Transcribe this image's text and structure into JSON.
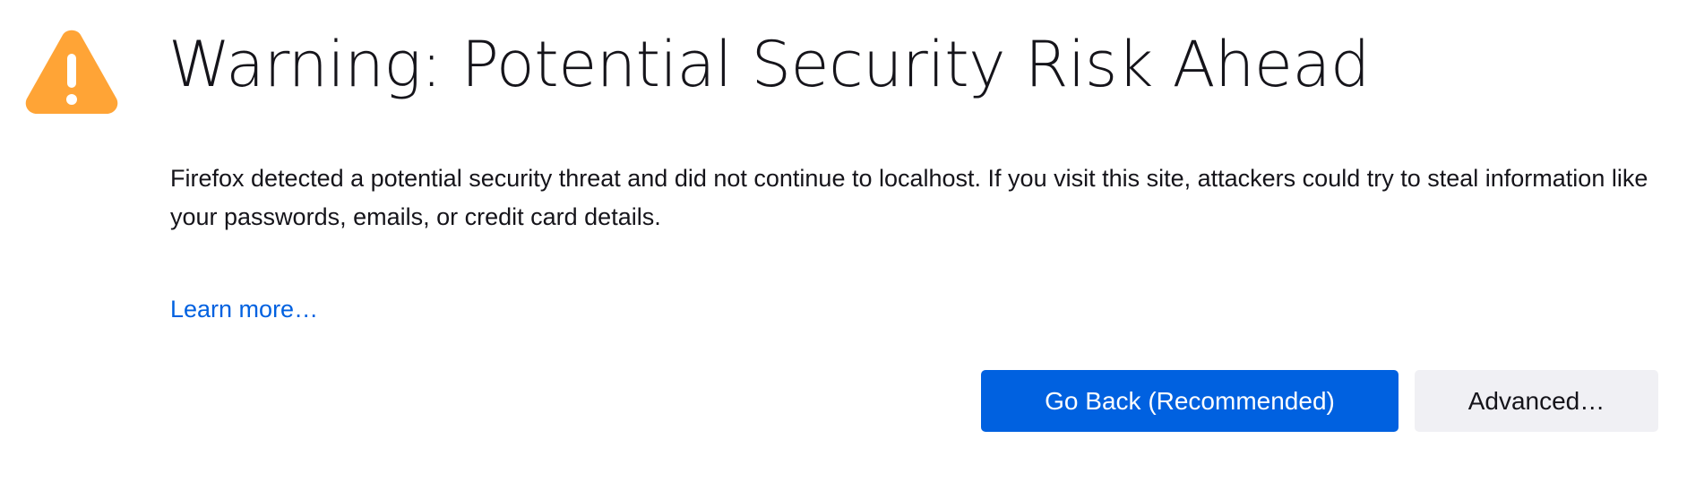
{
  "warning": {
    "icon": "warning-triangle-icon",
    "icon_color": "#ffa436",
    "title": "Warning: Potential Security Risk Ahead",
    "description": "Firefox detected a potential security threat and did not continue to localhost. If you visit this site, attackers could try to steal information like your passwords, emails, or credit card details.",
    "learn_more": "Learn more…"
  },
  "actions": {
    "go_back": "Go Back (Recommended)",
    "advanced": "Advanced…"
  },
  "colors": {
    "primary": "#0061e0",
    "secondary_bg": "#f0f0f4",
    "text": "#15141a",
    "link": "#0061e0"
  }
}
